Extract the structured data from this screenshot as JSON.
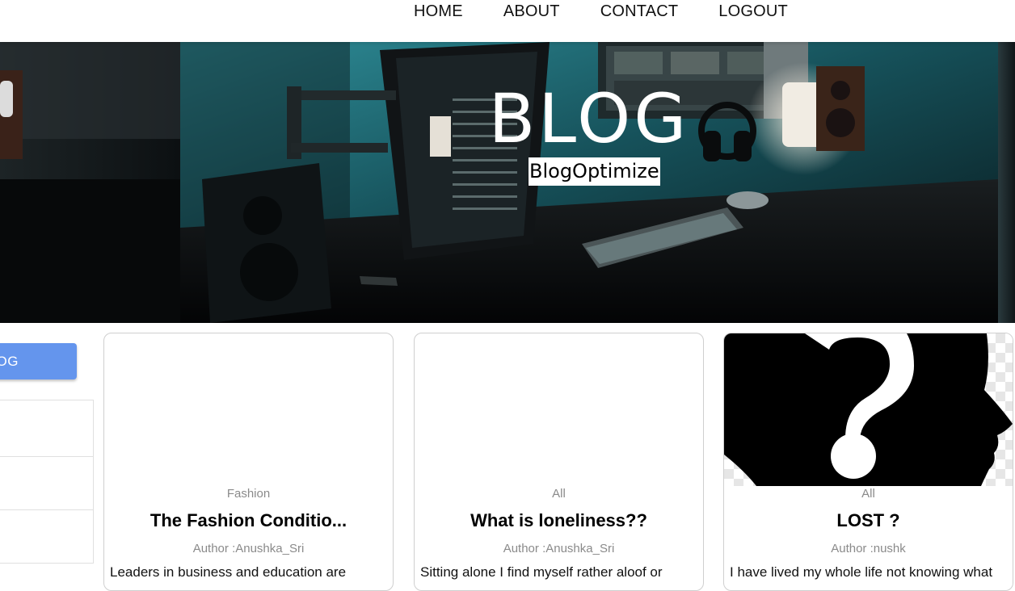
{
  "nav": {
    "items": [
      {
        "label": "HOME"
      },
      {
        "label": "ABOUT"
      },
      {
        "label": "CONTACT"
      },
      {
        "label": "LOGOUT"
      }
    ]
  },
  "hero": {
    "title": "BLOG",
    "subtitle": "BlogOptimize"
  },
  "sidebar": {
    "create_button_label": "OG"
  },
  "posts": [
    {
      "category": "Fashion",
      "title": "The Fashion Conditio...",
      "author": "Author :Anushka_Sri",
      "description": "Leaders in business and education are"
    },
    {
      "category": "All",
      "title": "What is loneliness??",
      "author": "Author :Anushka_Sri",
      "description": "Sitting alone I find myself rather aloof or"
    },
    {
      "category": "All",
      "title": "LOST ?",
      "author": "Author :nushk",
      "description": "I have lived my whole life not knowing what"
    }
  ],
  "colors": {
    "accent": "#6495ed",
    "muted_text": "#8a8a8a"
  }
}
